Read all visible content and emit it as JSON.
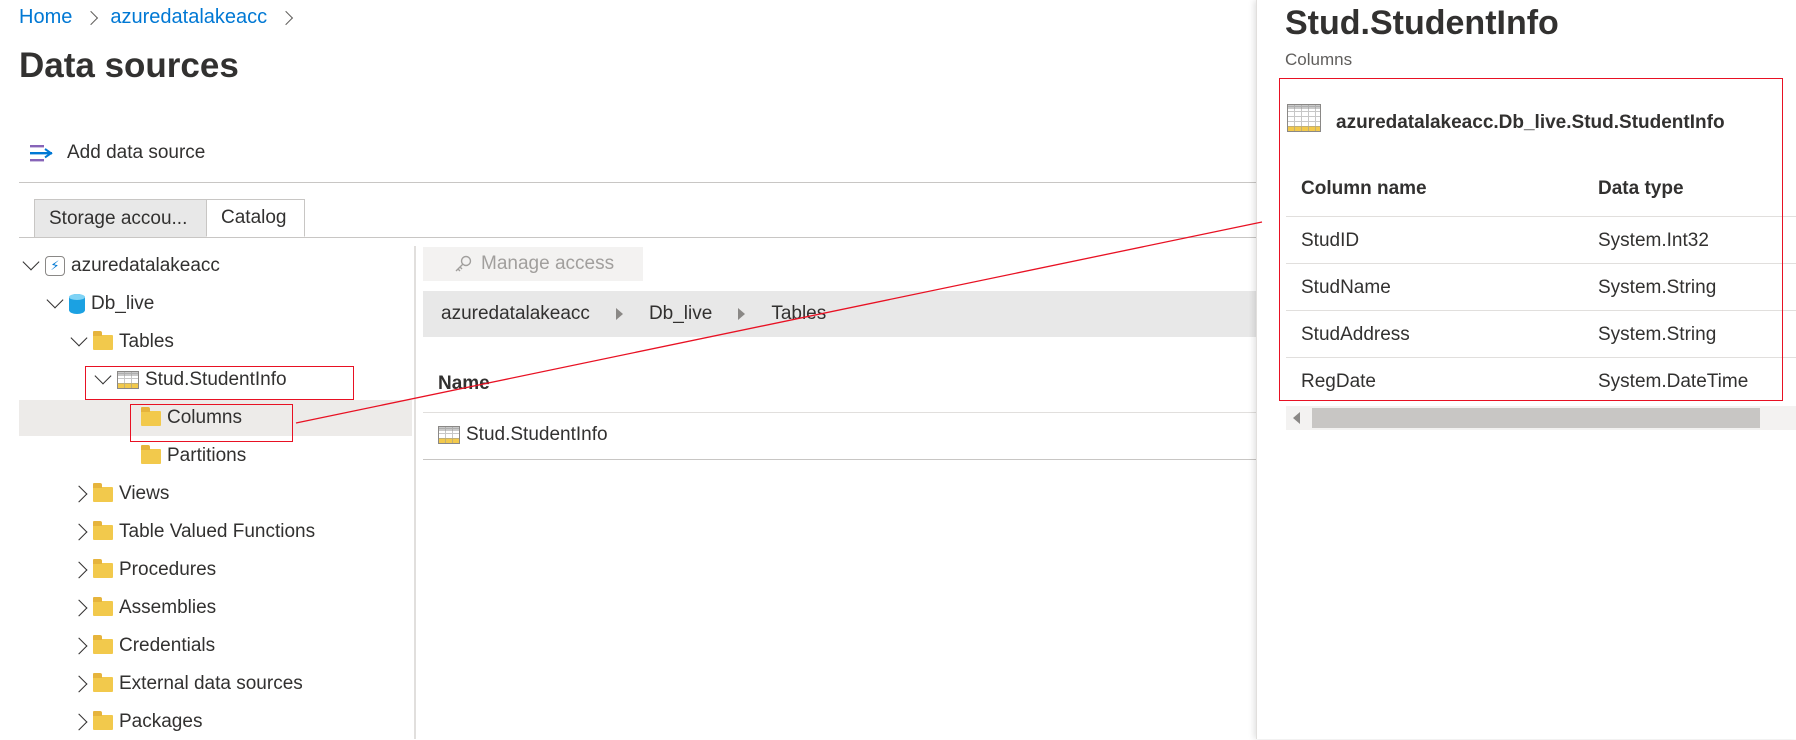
{
  "breadcrumb": {
    "home": "Home",
    "account": "azuredatalakeacc"
  },
  "page_title": "Data sources",
  "toolbar": {
    "add_label": "Add data source"
  },
  "tabs": [
    {
      "label": "Storage accou..."
    },
    {
      "label": "Catalog"
    }
  ],
  "tree": {
    "account": "azuredatalakeacc",
    "database": "Db_live",
    "tables_folder": "Tables",
    "table": "Stud.StudentInfo",
    "columns": "Columns",
    "partitions": "Partitions",
    "views": "Views",
    "tvf": "Table Valued Functions",
    "procedures": "Procedures",
    "assemblies": "Assemblies",
    "credentials": "Credentials",
    "external": "External data sources",
    "packages": "Packages"
  },
  "middle": {
    "manage_access": "Manage access",
    "path": [
      "azuredatalakeacc",
      "Db_live",
      "Tables"
    ],
    "name_header": "Name",
    "rows": [
      "Stud.StudentInfo"
    ]
  },
  "panel": {
    "title": "Stud.StudentInfo",
    "subtitle": "Columns",
    "full_name": "azuredatalakeacc.Db_live.Stud.StudentInfo",
    "headers": {
      "name": "Column name",
      "type": "Data type"
    },
    "columns": [
      {
        "name": "StudID",
        "type": "System.Int32"
      },
      {
        "name": "StudName",
        "type": "System.String"
      },
      {
        "name": "StudAddress",
        "type": "System.String"
      },
      {
        "name": "RegDate",
        "type": "System.DateTime"
      }
    ]
  },
  "colors": {
    "link": "#0078d4",
    "annotation": "#e81123"
  }
}
